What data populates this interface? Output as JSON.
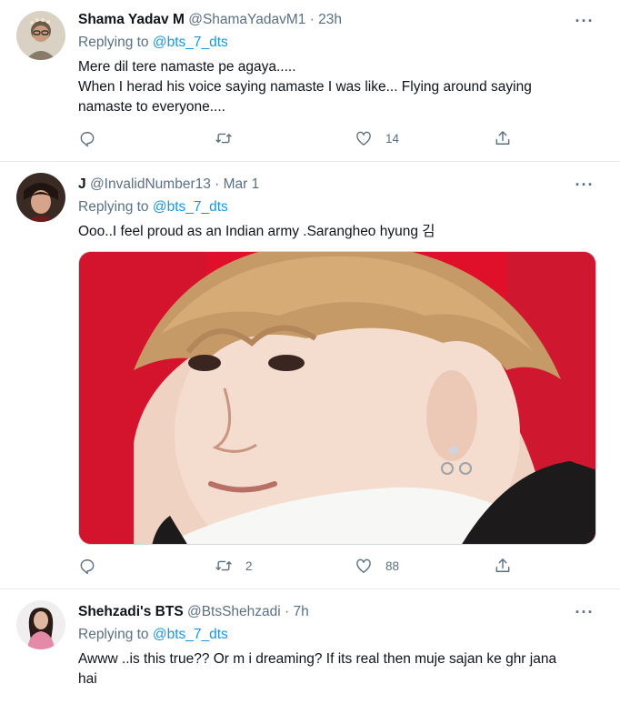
{
  "tweets": [
    {
      "name": "Shama Yadav M",
      "handle": "@ShamaYadavM1",
      "time": "· 23h",
      "replying_prefix": "Replying to",
      "replying_to": "@bts_7_dts",
      "text_line1": "Mere dil tere namaste pe agaya.....",
      "text_line2": "When I herad his voice saying namaste I was like... Flying around saying",
      "text_line3": "namaste to everyone....",
      "reply_count": "",
      "retweet_count": "",
      "like_count": "14"
    },
    {
      "name": "J",
      "handle": "@InvalidNumber13",
      "time": "· Mar 1",
      "replying_prefix": "Replying to",
      "replying_to": "@bts_7_dts",
      "text_line1": "Ooo..I feel proud as an Indian army .Sarangheo hyung 김",
      "reply_count": "",
      "retweet_count": "2",
      "like_count": "88"
    },
    {
      "name": "Shehzadi's BTS",
      "handle": "@BtsShehzadi",
      "time": "· 7h",
      "replying_prefix": "Replying to",
      "replying_to": "@bts_7_dts",
      "text_line1": "Awww ..is this true?? Or m i dreaming? If its real then muje sajan ke ghr jana",
      "text_line2": "hai"
    }
  ],
  "icons": {
    "reply": "reply-icon",
    "retweet": "retweet-icon",
    "like": "heart-icon",
    "share": "share-icon",
    "more": "more-icon"
  },
  "colors": {
    "link": "#1b95e0",
    "secondary_text": "#5b7083",
    "divider": "#e6ecf0"
  }
}
